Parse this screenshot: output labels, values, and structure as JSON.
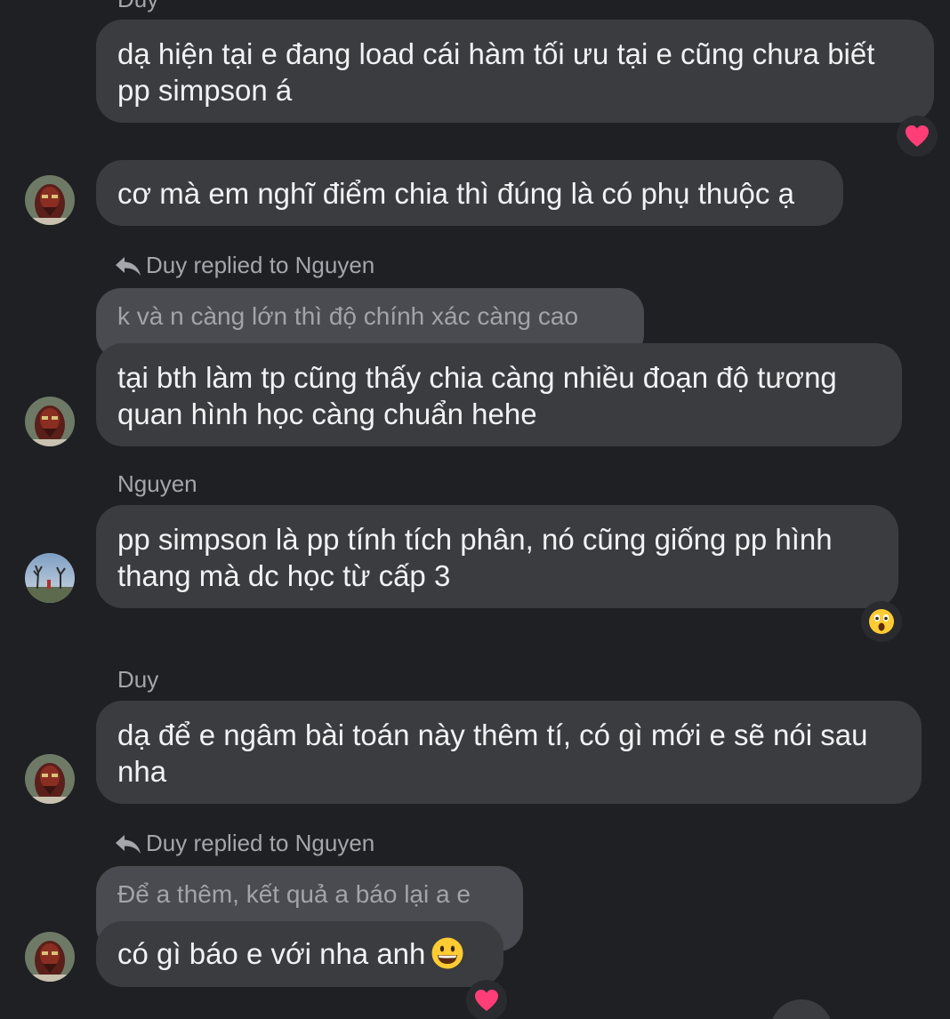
{
  "messages": [
    {
      "sender": "Duy",
      "text_line1": "dạ hiện tại e đang load cái hàm tối ưu tại e cũng chưa biết",
      "text_line2": "pp simpson á",
      "reaction": "heart"
    },
    {
      "text": "cơ mà em nghĩ điểm chia thì đúng là có phụ thuộc ạ"
    },
    {
      "reply_label": "Duy replied to Nguyen",
      "quoted": "k và n càng lớn thì độ chính xác càng cao",
      "text_line1": "tại bth làm tp cũng thấy chia càng nhiều đoạn độ tương",
      "text_line2": "quan hình học càng chuẩn hehe"
    },
    {
      "sender": "Nguyen",
      "text_line1": "pp simpson là pp tính tích phân, nó cũng giống pp hình",
      "text_line2": "thang mà dc học từ cấp 3",
      "reaction": "astonished-face"
    },
    {
      "sender": "Duy",
      "text_line1": "dạ để e ngâm bài toán này thêm tí, có gì mới e sẽ nói sau",
      "text_line2": "nha"
    },
    {
      "reply_label": "Duy replied to Nguyen",
      "quoted": "Để a thêm, kết quả a báo lại a e",
      "text": "có gì báo e với nha anh",
      "inline_emoji": "grinning-face",
      "reaction": "heart"
    }
  ],
  "colors": {
    "background": "#1f2023",
    "bubble": "#3b3c40",
    "quote_bubble": "#4a4b50",
    "meta_text": "#a5a6ab",
    "heart": "#ff3d77"
  }
}
